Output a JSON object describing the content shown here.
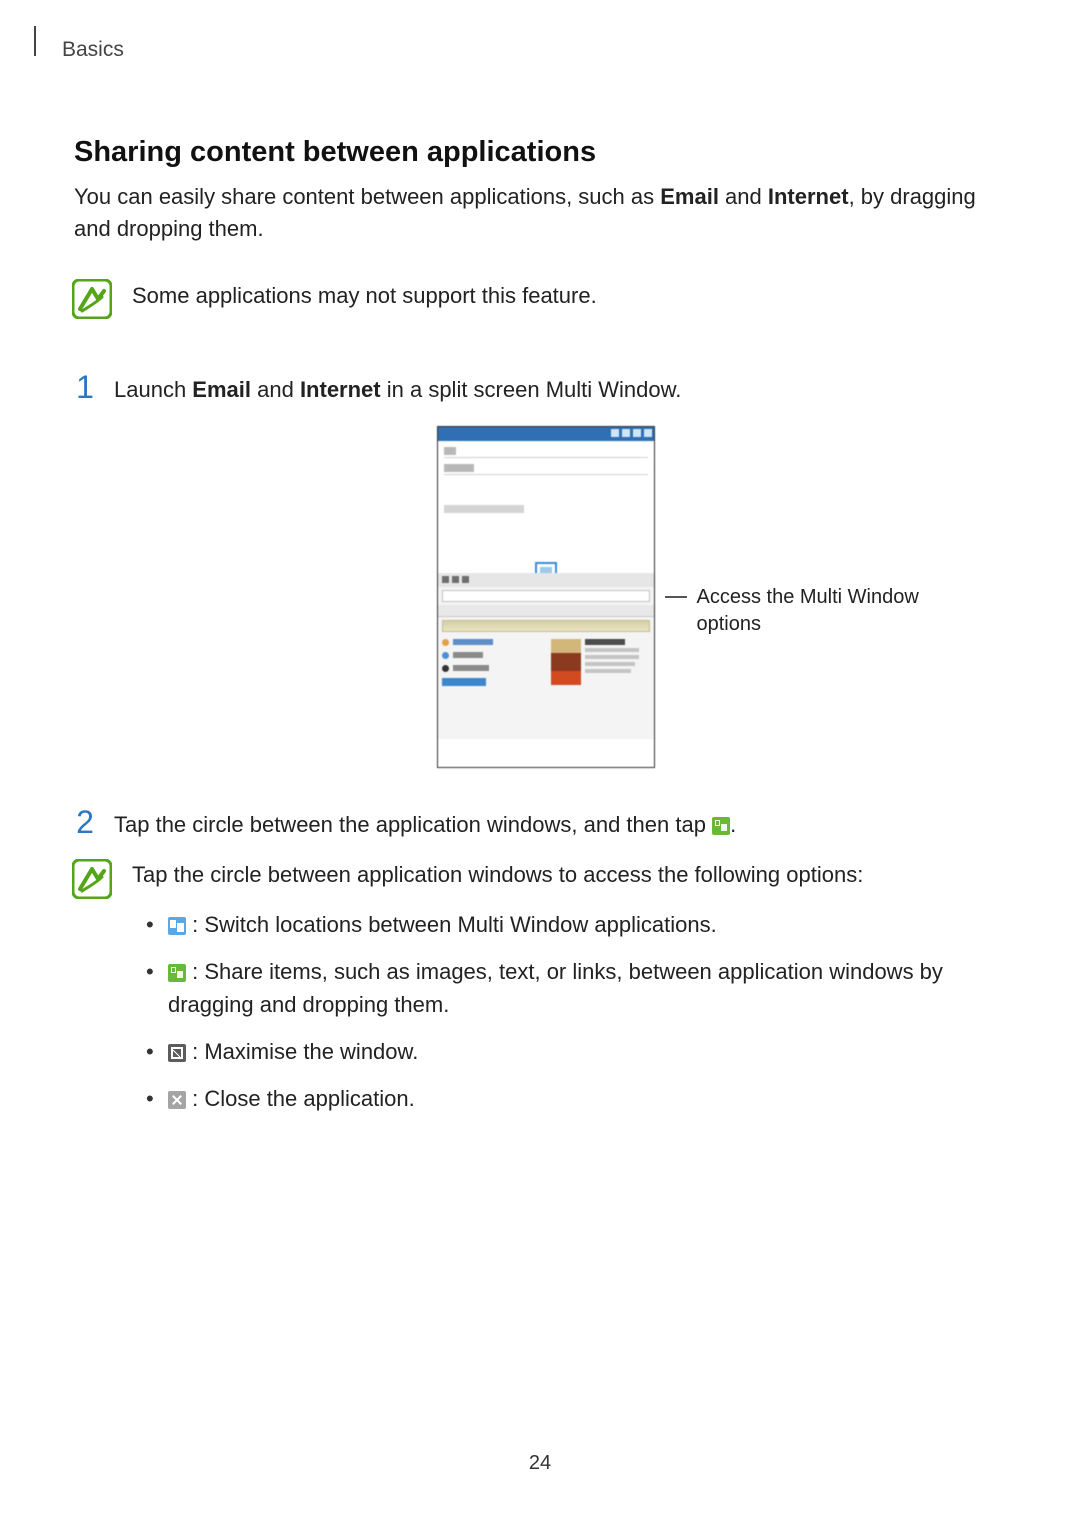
{
  "header": {
    "breadcrumb": "Basics"
  },
  "section": {
    "heading": "Sharing content between applications",
    "intro_before_bold1": "You can easily share content between applications, such as ",
    "intro_bold1": "Email",
    "intro_mid": " and ",
    "intro_bold2": "Internet",
    "intro_after_bold2": ", by dragging and dropping them."
  },
  "note_support": {
    "text": "Some applications may not support this feature."
  },
  "steps": [
    {
      "num": "1",
      "before_bold1": "Launch ",
      "bold1": "Email",
      "mid": " and ",
      "bold2": "Internet",
      "after_bold2": " in a split screen Multi Window."
    },
    {
      "num": "2",
      "text_before_icon": "Tap the circle between the application windows, and then tap ",
      "text_after_icon": "."
    }
  ],
  "figure": {
    "callout": "Access the Multi Window options"
  },
  "options_note": {
    "intro": "Tap the circle between application windows to access the following options:",
    "items": [
      {
        "icon": "switch-icon",
        "text": " : Switch locations between Multi Window applications."
      },
      {
        "icon": "share-icon",
        "text": " : Share items, such as images, text, or links, between application windows by dragging and dropping them."
      },
      {
        "icon": "maximise-icon",
        "text": " : Maximise the window."
      },
      {
        "icon": "close-icon",
        "text": " : Close the application."
      }
    ]
  },
  "page_number": "24"
}
